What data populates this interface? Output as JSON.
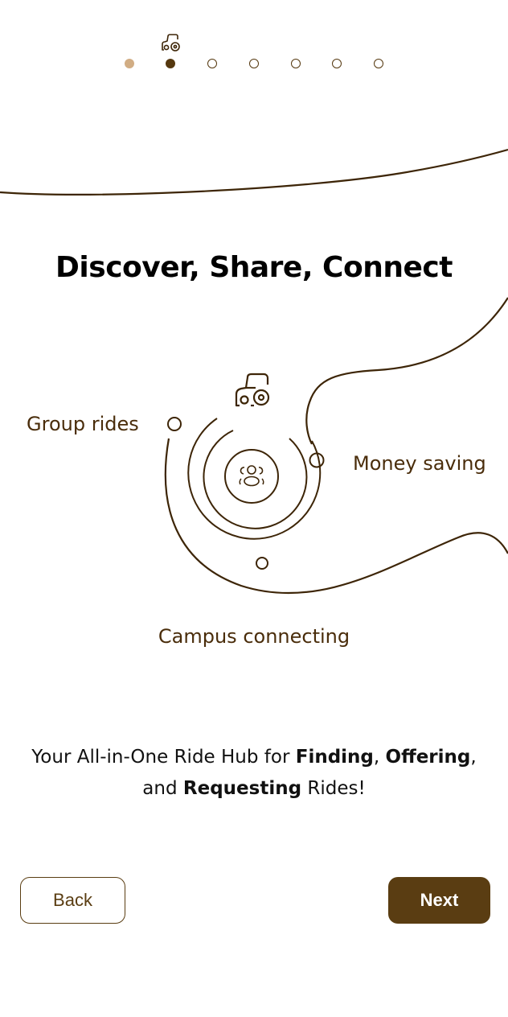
{
  "onboarding": {
    "steps_total": 7,
    "current_step": 2,
    "title": "Discover, Share, Connect",
    "features": {
      "group_rides": "Group rides",
      "money_saving": "Money saving",
      "campus_connecting": "Campus connecting"
    },
    "tagline": {
      "pre": "Your All-in-One Ride Hub for ",
      "w1": "Finding",
      "sep1": ", ",
      "w2": "Offering",
      "sep2": ",",
      "sep3": "and ",
      "w3": "Requesting",
      "post": " Rides!"
    }
  },
  "nav": {
    "back_label": "Back",
    "next_label": "Next"
  },
  "icons": {
    "progress_marker": "car-icon",
    "center_icon": "users-icon",
    "top_icon": "car-icon"
  },
  "colors": {
    "brand": "#5a3d12",
    "dot_done": "#d1ad84",
    "text_dark": "#000000",
    "line": "#3d2507"
  }
}
